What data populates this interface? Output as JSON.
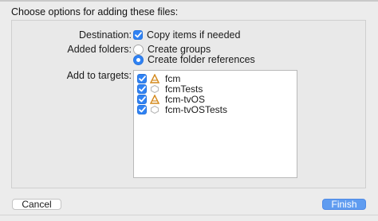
{
  "header": {
    "title": "Choose options for adding these files:"
  },
  "options": {
    "destination": {
      "label": "Destination:",
      "option": "Copy items if needed",
      "checked": true
    },
    "added_folders": {
      "label": "Added folders:",
      "choices": [
        {
          "label": "Create groups",
          "selected": false
        },
        {
          "label": "Create folder references",
          "selected": true
        }
      ]
    },
    "targets": {
      "label": "Add to targets:",
      "items": [
        {
          "name": "fcm",
          "checked": true,
          "icon": "app-icon"
        },
        {
          "name": "fcmTests",
          "checked": true,
          "icon": "test-bundle-icon"
        },
        {
          "name": "fcm-tvOS",
          "checked": true,
          "icon": "app-icon"
        },
        {
          "name": "fcm-tvOSTests",
          "checked": true,
          "icon": "test-bundle-icon"
        }
      ]
    }
  },
  "buttons": {
    "cancel": "Cancel",
    "finish": "Finish"
  },
  "colors": {
    "accent": "#2f82f4",
    "finish_button": "#5f9cf0",
    "background": "#ececec"
  }
}
